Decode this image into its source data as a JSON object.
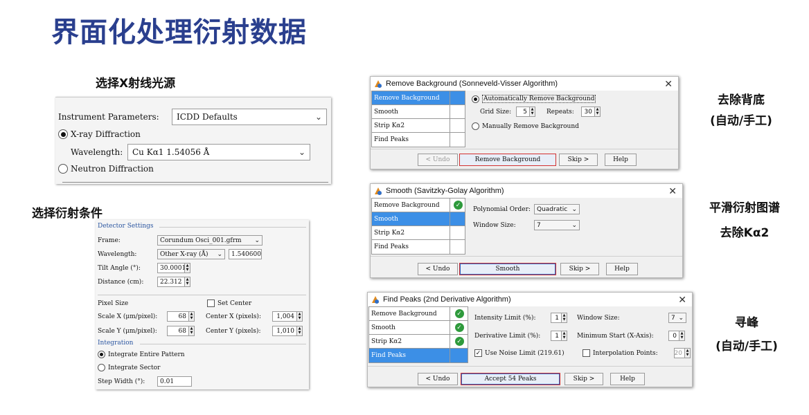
{
  "title": "界面化处理衍射数据",
  "captions": {
    "source": "选择X射线光源",
    "diffraction": "选择衍射条件",
    "bg_line1": "去除背底",
    "bg_line2": "(自动/手工)",
    "smooth_line1": "平滑衍射图谱",
    "smooth_line2": "去除Kα2",
    "peak_line1": "寻峰",
    "peak_line2": "(自动/手工)"
  },
  "instrument": {
    "params_label": "Instrument Parameters:",
    "params_value": "ICDD Defaults",
    "xray_label": "X-ray Diffraction",
    "wavelength_label": "Wavelength:",
    "wavelength_value": "Cu Kα1 1.54056 Å",
    "neutron_label": "Neutron Diffraction"
  },
  "detector": {
    "section": "Detector Settings",
    "frame_label": "Frame:",
    "frame_value": "Corundum Osci_001.gfrm",
    "wavelength_label": "Wavelength:",
    "wavelength_select": "Other X-ray (Å)",
    "wavelength_value": "1.540600",
    "tilt_label": "Tilt Angle (°):",
    "tilt_value": "30.0001",
    "distance_label": "Distance (cm):",
    "distance_value": "22.312",
    "pixel_size_label": "Pixel Size",
    "set_center_label": "Set Center",
    "scale_x_label": "Scale X (μm/pixel):",
    "scale_x_value": "68",
    "center_x_label": "Center X (pixels):",
    "center_x_value": "1,004",
    "scale_y_label": "Scale Y (μm/pixel):",
    "scale_y_value": "68",
    "center_y_label": "Center Y (pixels):",
    "center_y_value": "1,010",
    "integration_label": "Integration",
    "integrate_entire": "Integrate Entire Pattern",
    "integrate_sector": "Integrate Sector",
    "step_width_label": "Step Width (°):",
    "step_width_value": "0.01"
  },
  "steps": [
    "Remove Background",
    "Smooth",
    "Strip Kα2",
    "Find Peaks"
  ],
  "bg_dialog": {
    "title": "Remove Background (Sonneveld-Visser Algorithm)",
    "auto_label": "Automatically Remove Background",
    "grid_label": "Grid Size:",
    "grid_value": "5",
    "repeats_label": "Repeats:",
    "repeats_value": "30",
    "manual_label": "Manually Remove Background",
    "undo": "< Undo",
    "action": "Remove Background",
    "skip": "Skip >",
    "help": "Help"
  },
  "smooth_dialog": {
    "title": "Smooth (Savitzky-Golay Algorithm)",
    "poly_label": "Polynomial Order:",
    "poly_value": "Quadratic",
    "window_label": "Window Size:",
    "window_value": "7",
    "undo": "< Undo",
    "action": "Smooth",
    "skip": "Skip >",
    "help": "Help"
  },
  "peaks_dialog": {
    "title": "Find Peaks (2nd Derivative Algorithm)",
    "intensity_label": "Intensity Limit (%):",
    "intensity_value": "1",
    "window_label": "Window Size:",
    "window_value": "7",
    "derivative_label": "Derivative Limit (%):",
    "derivative_value": "1",
    "min_start_label": "Minimum Start (X-Axis):",
    "min_start_value": "0",
    "noise_label": "Use Noise Limit (219.61)",
    "interp_label": "Interpolation Points:",
    "interp_value": "20",
    "undo": "< Undo",
    "action": "Accept 54 Peaks",
    "skip": "Skip >",
    "help": "Help"
  }
}
